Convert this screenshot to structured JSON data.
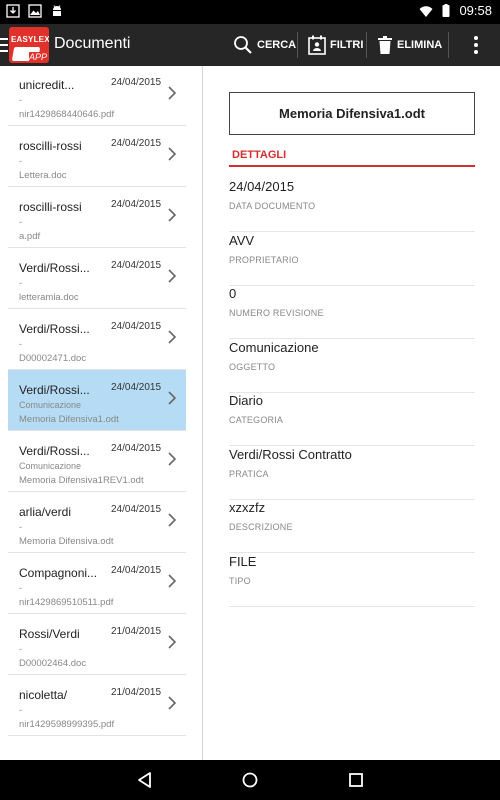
{
  "status_bar": {
    "time": "09:58"
  },
  "app": {
    "logo_text": "EASYLEX",
    "logo_subtext": "APP",
    "title": "Documenti"
  },
  "toolbar": {
    "search_label": "CERCA",
    "filters_label": "FILTRI",
    "delete_label": "ELIMINA"
  },
  "documents": [
    {
      "name": "unicredit...",
      "date": "24/04/2015",
      "subject": "-",
      "file": "nir1429868440646.pdf"
    },
    {
      "name": "roscilli-rossi",
      "date": "24/04/2015",
      "subject": "-",
      "file": "Lettera.doc"
    },
    {
      "name": "roscilli-rossi",
      "date": "24/04/2015",
      "subject": "-",
      "file": "a.pdf"
    },
    {
      "name": "Verdi/Rossi...",
      "date": "24/04/2015",
      "subject": "-",
      "file": "letteramia.doc"
    },
    {
      "name": "Verdi/Rossi...",
      "date": "24/04/2015",
      "subject": "-",
      "file": "D00002471.doc"
    },
    {
      "name": "Verdi/Rossi...",
      "date": "24/04/2015",
      "subject": "Comunicazione",
      "file": "Memoria Difensiva1.odt"
    },
    {
      "name": "Verdi/Rossi...",
      "date": "24/04/2015",
      "subject": "Comunicazione",
      "file": "Memoria Difensiva1REV1.odt"
    },
    {
      "name": "arlia/verdi",
      "date": "24/04/2015",
      "subject": "-",
      "file": "Memoria Difensiva.odt"
    },
    {
      "name": "Compagnoni...",
      "date": "24/04/2015",
      "subject": "-",
      "file": "nir1429869510511.pdf"
    },
    {
      "name": "Rossi/Verdi",
      "date": "21/04/2015",
      "subject": "-",
      "file": "D00002464.doc"
    },
    {
      "name": "nicoletta/",
      "date": "21/04/2015",
      "subject": "-",
      "file": "nir1429598999395.pdf"
    }
  ],
  "selected_index": 5,
  "detail": {
    "file_name": "Memoria Difensiva1.odt",
    "section_title": "DETTAGLI",
    "fields": [
      {
        "value": "24/04/2015",
        "label": "DATA DOCUMENTO"
      },
      {
        "value": "AVV",
        "label": "PROPRIETARIO"
      },
      {
        "value": "0",
        "label": "NUMERO REVISIONE"
      },
      {
        "value": "Comunicazione",
        "label": "OGGETTO"
      },
      {
        "value": "Diario",
        "label": "CATEGORIA"
      },
      {
        "value": "Verdi/Rossi Contratto",
        "label": "PRATICA"
      },
      {
        "value": "xzxzfz",
        "label": "DESCRIZIONE"
      },
      {
        "value": "FILE",
        "label": "TIPO"
      }
    ]
  },
  "colors": {
    "action_bar": "#262626",
    "accent_red": "#d32f2f",
    "selected_row": "#b5dcf4"
  }
}
